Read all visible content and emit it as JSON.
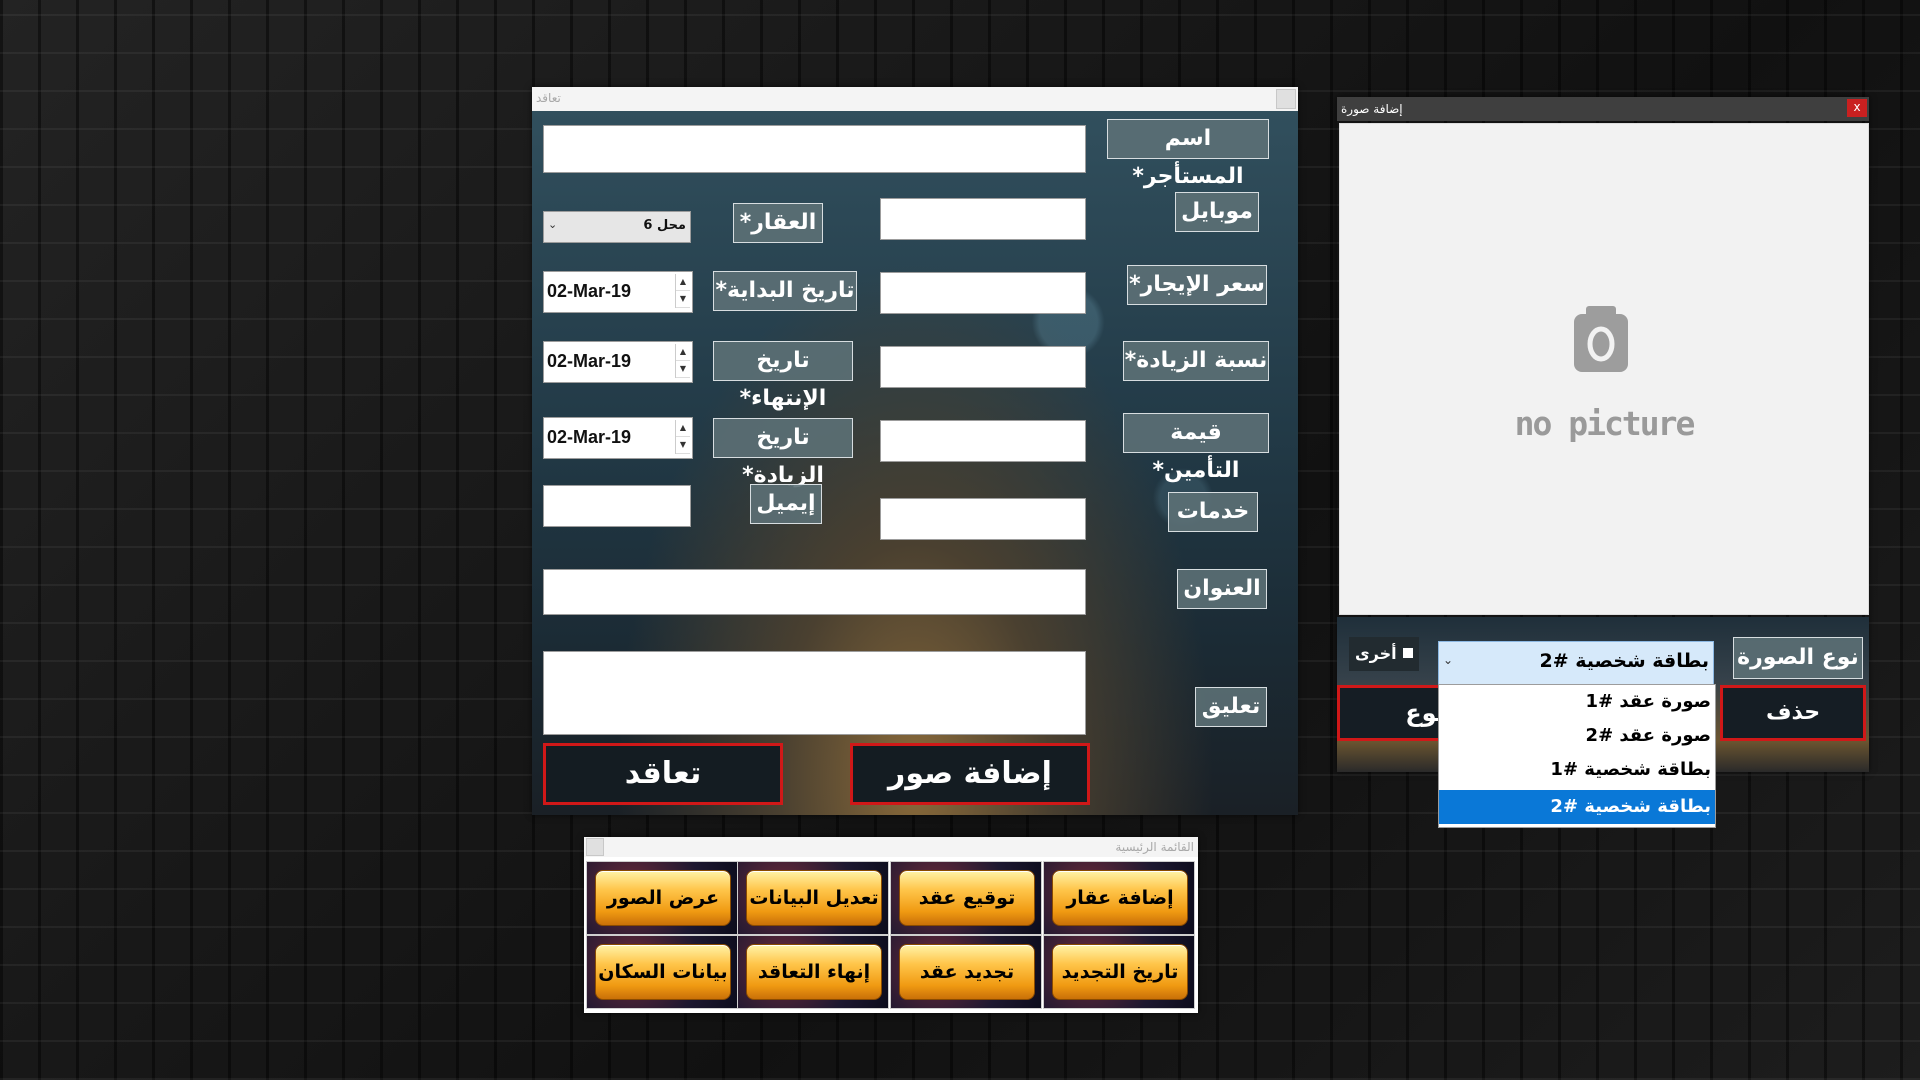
{
  "contract_window": {
    "title": "تعاقد",
    "labels": {
      "tenant_name": "اسم المستأجر*",
      "mobile": "موبايل",
      "property": "العقار*",
      "rent_price": "سعر الإيجار*",
      "start_date": "تاريخ البداية*",
      "increase_rate": "نسبة الزيادة*",
      "end_date": "تاريخ الإنتهاء*",
      "insurance_value": "قيمة التأمين*",
      "increase_date": "تاريخ الزيادة*",
      "services": "خدمات",
      "email": "إيميل",
      "address": "العنوان",
      "comment": "تعليق"
    },
    "property_selected": "محل 6",
    "start_date_value": "02-Mar-19",
    "end_date_value": "02-Mar-19",
    "increase_date_value": "02-Mar-19",
    "buttons": {
      "contract": "تعاقد",
      "add_photos": "إضافة صور"
    }
  },
  "main_menu": {
    "title": "القائمة الرئيسية",
    "buttons": [
      "إضافة عقار",
      "توقيع عقد",
      "تعديل البيانات",
      "عرض الصور",
      "تاريخ التجديد",
      "تجديد عقد",
      "إنهاء التعاقد",
      "بيانات السكان"
    ]
  },
  "add_picture_window": {
    "title": "إضافة صورة",
    "close": "x",
    "placeholder_text": "no picture",
    "image_type_label": "نوع الصورة",
    "other_label": "أخرى",
    "selected_type": "بطاقة شخصية #2",
    "options": [
      "صورة عقد #1",
      "صورة عقد #2",
      "بطاقة شخصية #1",
      "بطاقة شخصية #2"
    ],
    "delete_button": "حذف",
    "back_button_partial": "جوع"
  },
  "colors": {
    "label_bg": "#5c7076",
    "red_border": "#d01818",
    "gold_button": "#f6b02a",
    "highlight": "#0a78d7"
  }
}
